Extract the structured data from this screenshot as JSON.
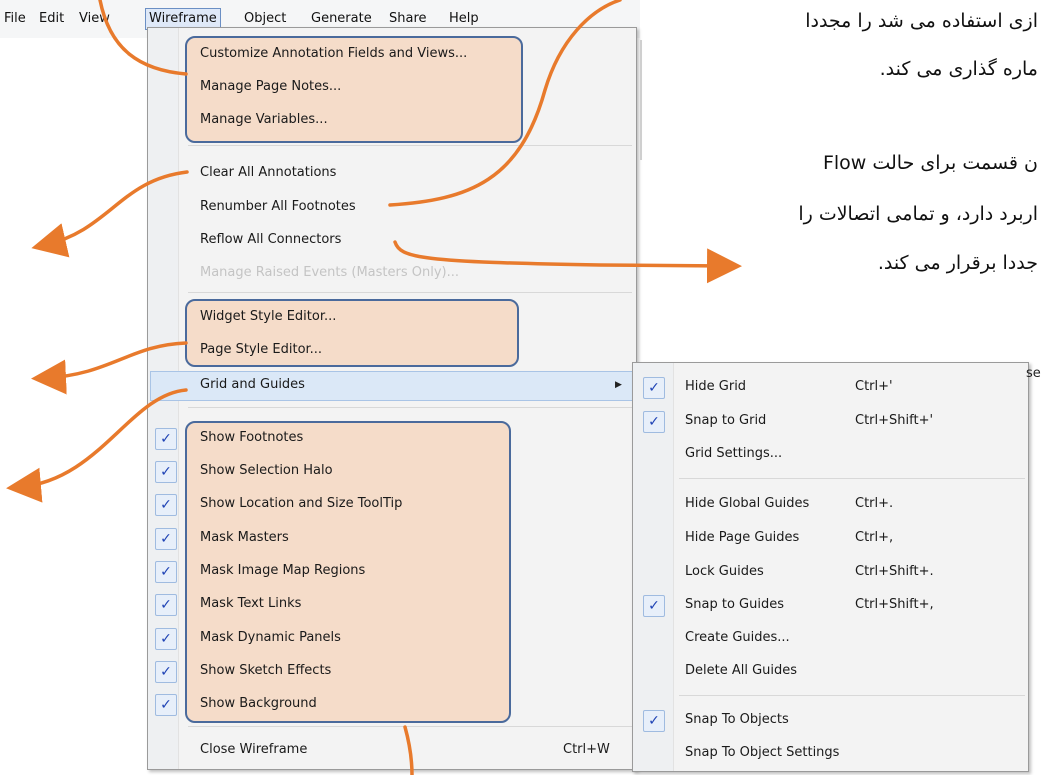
{
  "menubar": {
    "items": [
      "File",
      "Edit",
      "View",
      "Wireframe",
      "Object",
      "Generate",
      "Share",
      "Help"
    ],
    "active": "Wireframe"
  },
  "wireframe_menu": {
    "group1": [
      "Customize Annotation Fields and Views...",
      "Manage Page Notes...",
      "Manage Variables..."
    ],
    "group2": [
      "Clear All Annotations",
      "Renumber All Footnotes",
      "Reflow All Connectors",
      "Manage Raised Events (Masters Only)..."
    ],
    "group3": [
      "Widget Style Editor...",
      "Page Style Editor..."
    ],
    "grid_and_guides": "Grid and Guides",
    "toggles": [
      "Show Footnotes",
      "Show Selection Halo",
      "Show Location and Size ToolTip",
      "Mask Masters",
      "Mask Image Map Regions",
      "Mask Text Links",
      "Mask Dynamic Panels",
      "Show Sketch Effects",
      "Show Background"
    ],
    "close": {
      "label": "Close Wireframe",
      "shortcut": "Ctrl+W"
    }
  },
  "grid_submenu": {
    "group1": [
      {
        "label": "Hide Grid",
        "shortcut": "Ctrl+'",
        "checked": true
      },
      {
        "label": "Snap to Grid",
        "shortcut": "Ctrl+Shift+'",
        "checked": true
      },
      {
        "label": "Grid Settings...",
        "shortcut": "",
        "checked": false
      }
    ],
    "group2": [
      {
        "label": "Hide Global Guides",
        "shortcut": "Ctrl+.",
        "checked": false
      },
      {
        "label": "Hide Page Guides",
        "shortcut": "Ctrl+,",
        "checked": false
      },
      {
        "label": "Lock Guides",
        "shortcut": "Ctrl+Shift+.",
        "checked": false
      },
      {
        "label": "Snap to Guides",
        "shortcut": "Ctrl+Shift+,",
        "checked": true
      },
      {
        "label": "Create Guides...",
        "shortcut": "",
        "checked": false
      },
      {
        "label": "Delete All Guides",
        "shortcut": "",
        "checked": false
      }
    ],
    "group3": [
      {
        "label": "Snap To Objects",
        "shortcut": "",
        "checked": true
      },
      {
        "label": "Snap To Object Settings",
        "shortcut": "",
        "checked": false
      }
    ]
  },
  "annotation_text": {
    "line1": "ازی استفاده می شد را مجددا",
    "line2": "ماره گذاری می کند.",
    "line3": "ن قسمت برای حالت Flow",
    "line4": "اربرد دارد، و تمامی اتصالات را",
    "line5": "جددا برقرار می کند."
  },
  "colors": {
    "highlight_fill": "#f5dcc9",
    "highlight_border": "#4a6a9c",
    "arrow": "#e87a2c",
    "check": "#1f43b5"
  }
}
